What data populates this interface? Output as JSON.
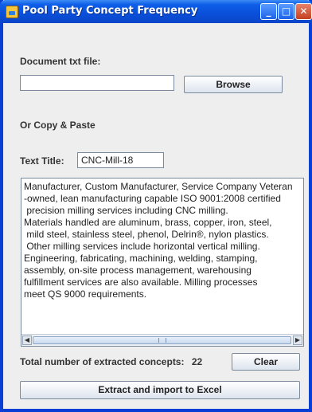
{
  "window": {
    "title": "Pool Party Concept Frequency",
    "minimize_glyph": "_",
    "maximize_glyph": "□",
    "close_glyph": "✕"
  },
  "form": {
    "doc_label": "Document txt file:",
    "doc_path_value": "",
    "browse_label": "Browse",
    "copy_paste_label": "Or Copy & Paste",
    "text_title_label": "Text Title:",
    "text_title_value": "CNC-Mill-18",
    "text_body": "Manufacturer, Custom Manufacturer, Service Company Veteran\n-owned, lean manufacturing capable ISO 9001:2008 certified\n precision milling services including CNC milling.\nMaterials handled are aluminum, brass, copper, iron, steel,\n mild steel, stainless steel, phenol, Delrin®, nylon plastics.\n Other milling services include horizontal vertical milling.\nEngineering, fabricating, machining, welding, stamping,\nassembly, on-site process management, warehousing\nfulfillment services are also available. Milling processes\nmeet QS 9000 requirements.",
    "total_label": "Total number of extracted concepts:",
    "total_value": "22",
    "clear_label": "Clear",
    "extract_label": "Extract and import to Excel"
  },
  "scrollbar": {
    "left_glyph": "◀",
    "right_glyph": "▶"
  }
}
